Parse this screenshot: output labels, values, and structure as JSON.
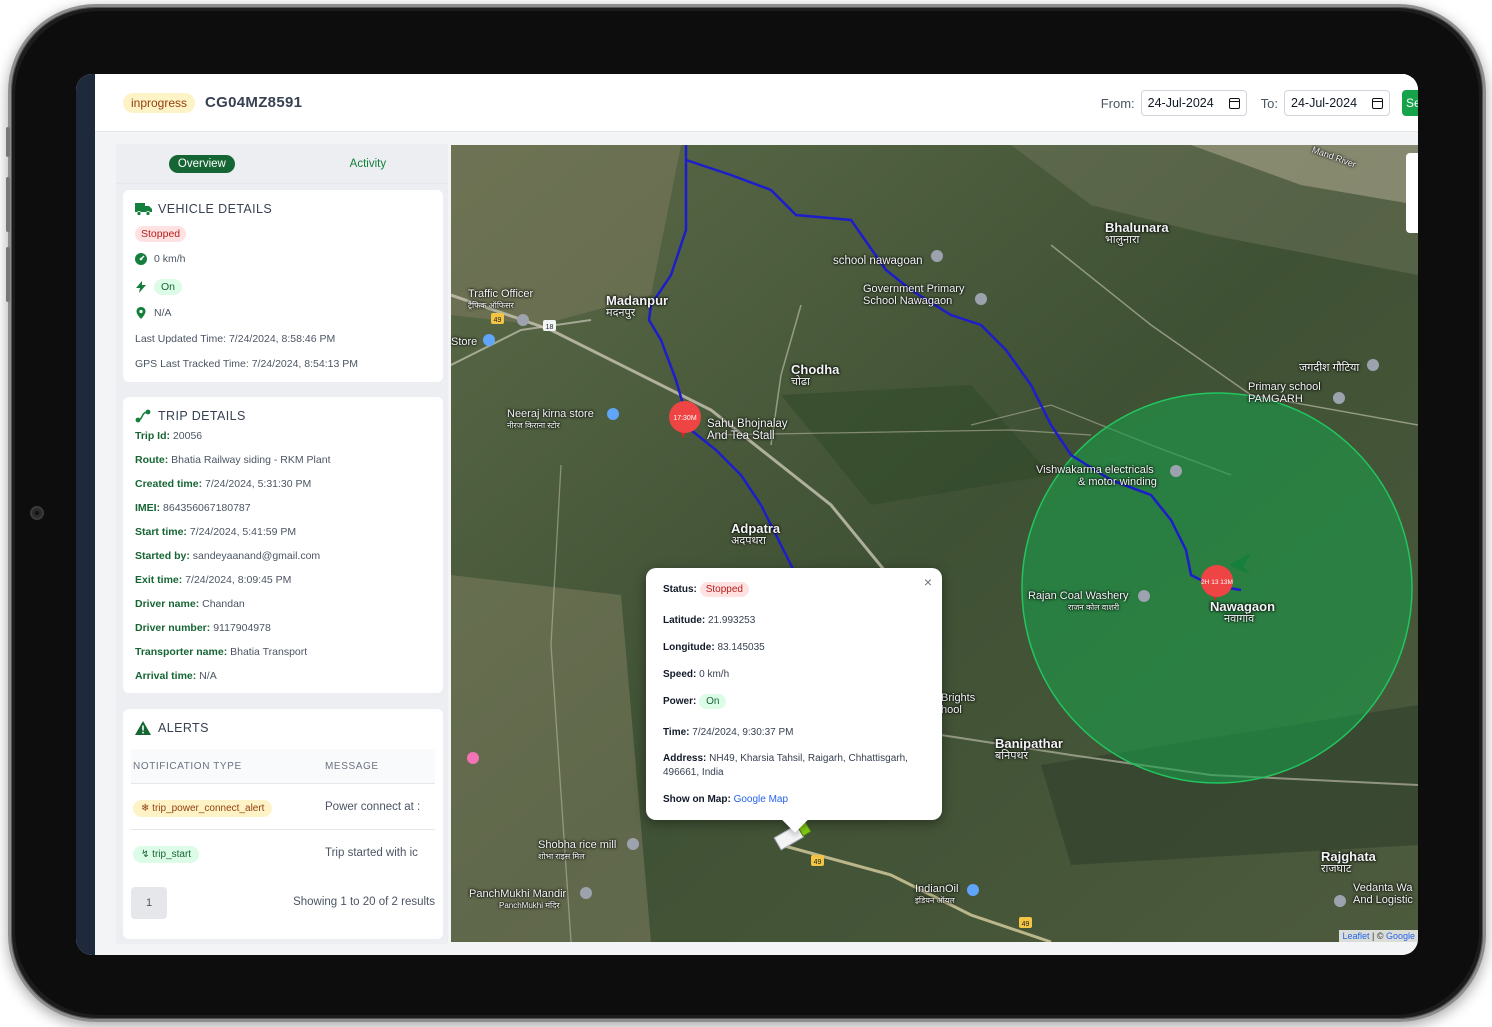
{
  "header": {
    "status_badge": "inprogress",
    "vehicle_number": "CG04MZ8591",
    "from_label": "From:",
    "from_date": "24-Jul-2024",
    "to_label": "To:",
    "to_date": "24-Jul-2024",
    "search_button": "Se"
  },
  "tabs": [
    {
      "label": "Overview",
      "active": true
    },
    {
      "label": "Activity",
      "active": false
    }
  ],
  "vehicle_details": {
    "title": "VEHICLE DETAILS",
    "status": "Stopped",
    "speed": "0 km/h",
    "power": "On",
    "location": "N/A",
    "last_updated": "Last Updated Time: 7/24/2024, 8:58:46 PM",
    "gps_last_tracked": "GPS Last Tracked Time: 7/24/2024, 8:54:13 PM"
  },
  "trip_details": {
    "title": "TRIP DETAILS",
    "fields": [
      {
        "label": "Trip Id:",
        "value": "20056"
      },
      {
        "label": "Route:",
        "value": "Bhatia Railway siding - RKM Plant"
      },
      {
        "label": "Created time:",
        "value": "7/24/2024, 5:31:30 PM"
      },
      {
        "label": "IMEI:",
        "value": "864356067180787"
      },
      {
        "label": "Start time:",
        "value": "7/24/2024, 5:41:59 PM"
      },
      {
        "label": "Started by:",
        "value": "sandeyaanand@gmail.com"
      },
      {
        "label": "Exit time:",
        "value": "7/24/2024, 8:09:45 PM"
      },
      {
        "label": "Driver name:",
        "value": "Chandan"
      },
      {
        "label": "Driver number:",
        "value": "9117904978"
      },
      {
        "label": "Transporter name:",
        "value": "Bhatia Transport"
      },
      {
        "label": "Arrival time:",
        "value": "N/A"
      }
    ]
  },
  "alerts": {
    "title": "ALERTS",
    "columns": [
      "NOTIFICATION TYPE",
      "MESSAGE"
    ],
    "rows": [
      {
        "type": "trip_power_connect_alert",
        "message": "Power connect at :",
        "color": "#fef3c7"
      },
      {
        "type": "trip_start",
        "message": "Trip started with ic",
        "color": "#dcfce7"
      }
    ],
    "page": "1",
    "showing": "Showing 1 to 20 of 2 results"
  },
  "map": {
    "labels": [
      {
        "text": "Madanpur",
        "sub": "मदनपुर"
      },
      {
        "text": "Traffic Officer",
        "sub": "ट्रैफिक ऑफिसर"
      },
      {
        "text": "Store"
      },
      {
        "text": "Neeraj kirna store",
        "sub": "नीरज किराना स्टोर"
      },
      {
        "text": "Sahu Bhojnalay",
        "sub": "And Tea Stall"
      },
      {
        "text": "Chodha",
        "sub": "चोढा"
      },
      {
        "text": "school nawagoan"
      },
      {
        "text": "Government Primary",
        "sub": "School Nawagaon"
      },
      {
        "text": "Bhalunara",
        "sub": "भालुनारा"
      },
      {
        "text": "जगदीश गौटिया"
      },
      {
        "text": "Primary school",
        "sub": "PAMGARH"
      },
      {
        "text": "Vishwakarma electricals",
        "sub": "& motor winding"
      },
      {
        "text": "Rajan Coal Washery",
        "sub": "राजन कोल वाशरी"
      },
      {
        "text": "Nawagaon",
        "sub": "नवागांव"
      },
      {
        "text": "Adpatra",
        "sub": "अदपथरा"
      },
      {
        "text": "Brights",
        "sub": "hool"
      },
      {
        "text": "Banipathar",
        "sub": "बनिपथर"
      },
      {
        "text": "Shobha rice mill",
        "sub": "शोभा राइस मिल"
      },
      {
        "text": "PanchMukhi Mandir",
        "sub": "PanchMukhi मंदिर"
      },
      {
        "text": "IndianOil",
        "sub": "इंडियन ऑयल"
      },
      {
        "text": "Rajghata",
        "sub": "राजघाट"
      },
      {
        "text": "Vedanta Wa",
        "sub": "And Logistic"
      },
      {
        "text": "Mand River"
      }
    ],
    "markers": [
      {
        "label": "17:30M",
        "color": "#ef4444"
      },
      {
        "label": "2H 13 13M",
        "color": "#ef4444"
      }
    ],
    "road_shields": [
      "49",
      "18",
      "49",
      "49"
    ],
    "route_color": "#1d1dcc",
    "geofence_color": "#16a34a",
    "attribution_leaflet": "Leaflet",
    "attribution_google": "Google"
  },
  "popup": {
    "status_label": "Status:",
    "status_value": "Stopped",
    "latitude_label": "Latitude:",
    "latitude_value": "21.993253",
    "longitude_label": "Longitude:",
    "longitude_value": "83.145035",
    "speed_label": "Speed:",
    "speed_value": "0 km/h",
    "power_label": "Power:",
    "power_value": "On",
    "time_label": "Time:",
    "time_value": "7/24/2024, 9:30:37 PM",
    "address_label": "Address:",
    "address_line1": "NH49, Kharsia Tahsil, Raigarh, Chhattisgarh,",
    "address_line2": "496661, India",
    "showmap_label": "Show on Map:",
    "showmap_link": "Google Map",
    "close": "×"
  }
}
